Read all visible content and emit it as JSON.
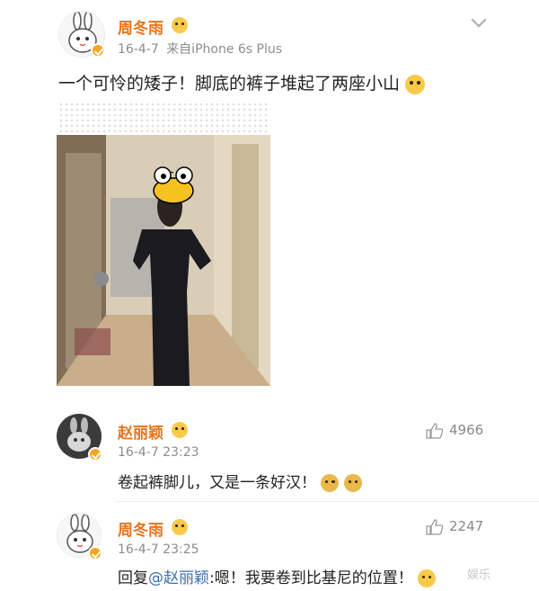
{
  "post": {
    "author": "周冬雨",
    "date": "16-4-7",
    "source": "来自iPhone 6s Plus",
    "text": "一个可怜的矮子！脚底的裤子堆起了两座小山"
  },
  "comments": [
    {
      "author": "赵丽颖",
      "time": "16-4-7 23:23",
      "likes": "4966",
      "text": "卷起裤脚儿，又是一条好汉！"
    },
    {
      "author": "周冬雨",
      "time": "16-4-7 23:25",
      "likes": "2247",
      "reply_prefix": "回复",
      "mention": "@赵丽颖",
      "text": ":嗯！我要卷到比基尼的位置！"
    }
  ],
  "watermark": "娱乐",
  "colors": {
    "username": "#e8741b",
    "mention": "#3b6fb0",
    "verified": "#f5a623"
  }
}
